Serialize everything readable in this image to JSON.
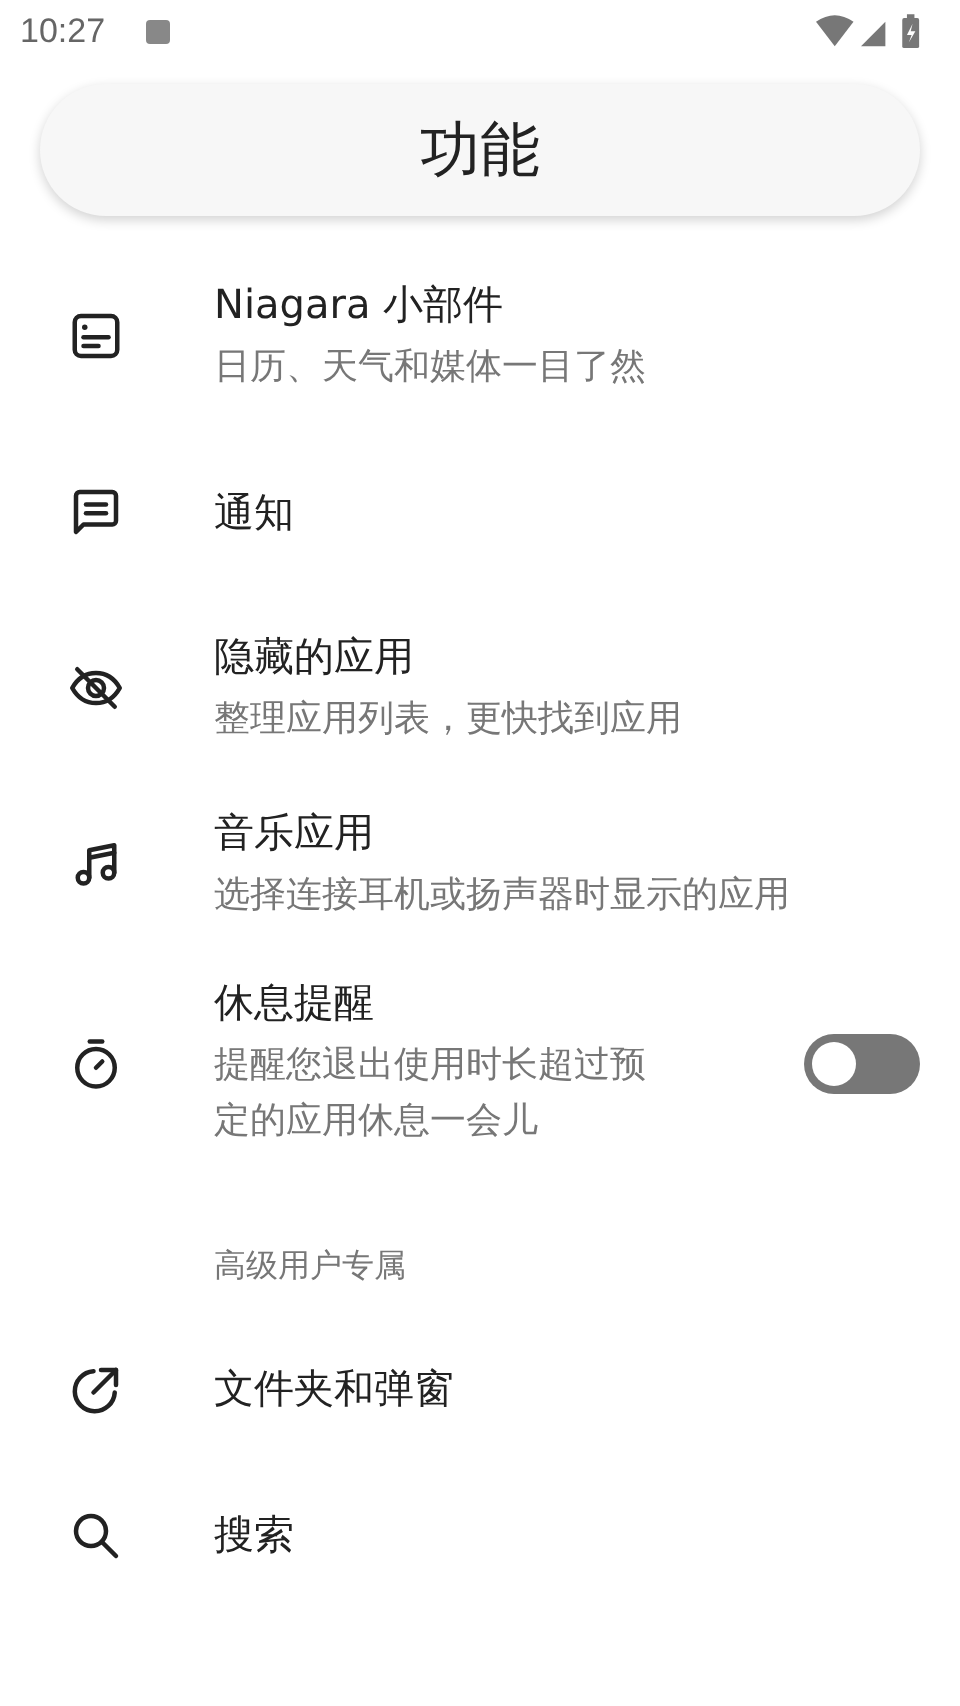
{
  "status_bar": {
    "time": "10:27"
  },
  "header": {
    "title": "功能"
  },
  "groups": [
    {
      "items": [
        {
          "title": "Niagara 小部件",
          "subtitle": "日历、天气和媒体一目了然"
        },
        {
          "title": "通知"
        },
        {
          "title": "隐藏的应用",
          "subtitle": "整理应用列表，更快找到应用"
        },
        {
          "title": "音乐应用",
          "subtitle": "选择连接耳机或扬声器时显示的应用"
        },
        {
          "title": "休息提醒",
          "subtitle": "提醒您退出使用时长超过预定的应用休息一会儿",
          "toggle": {
            "on": false
          }
        }
      ]
    },
    {
      "header": "高级用户专属",
      "items": [
        {
          "title": "文件夹和弹窗"
        },
        {
          "title": "搜索"
        }
      ]
    }
  ]
}
